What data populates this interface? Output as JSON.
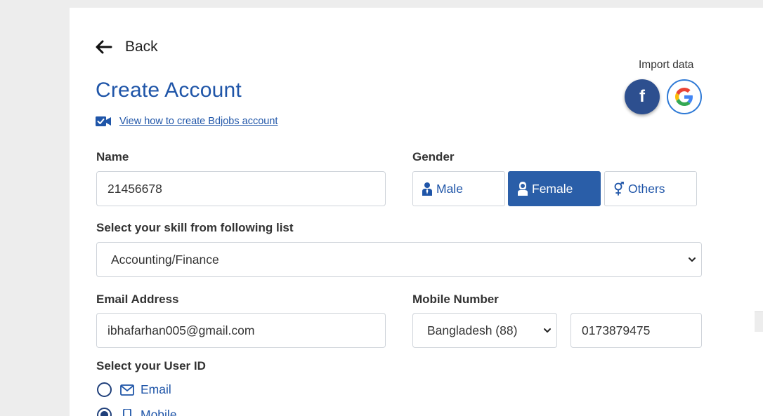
{
  "back": {
    "label": "Back"
  },
  "title": "Create Account",
  "howto_link": "View how to create Bdjobs account",
  "import": {
    "label": "Import data",
    "facebook_glyph": "f"
  },
  "name": {
    "label": "Name",
    "value": "21456678"
  },
  "gender": {
    "label": "Gender",
    "options": [
      "Male",
      "Female",
      "Others"
    ],
    "selected": "Female"
  },
  "skill": {
    "label": "Select your skill from following list",
    "selected": "Accounting/Finance"
  },
  "email": {
    "label": "Email Address",
    "value": "ibhafarhan005@gmail.com"
  },
  "mobile": {
    "label": "Mobile Number",
    "country": "Bangladesh (88)",
    "value": "0173879475"
  },
  "userid": {
    "label": "Select your User ID",
    "options": [
      "Email",
      "Mobile"
    ],
    "selected": "Mobile"
  },
  "colors": {
    "primary": "#1f55a8",
    "active_button": "#2a5ea8",
    "facebook": "#2d4f8f",
    "google_ring": "#2f7ad6"
  }
}
